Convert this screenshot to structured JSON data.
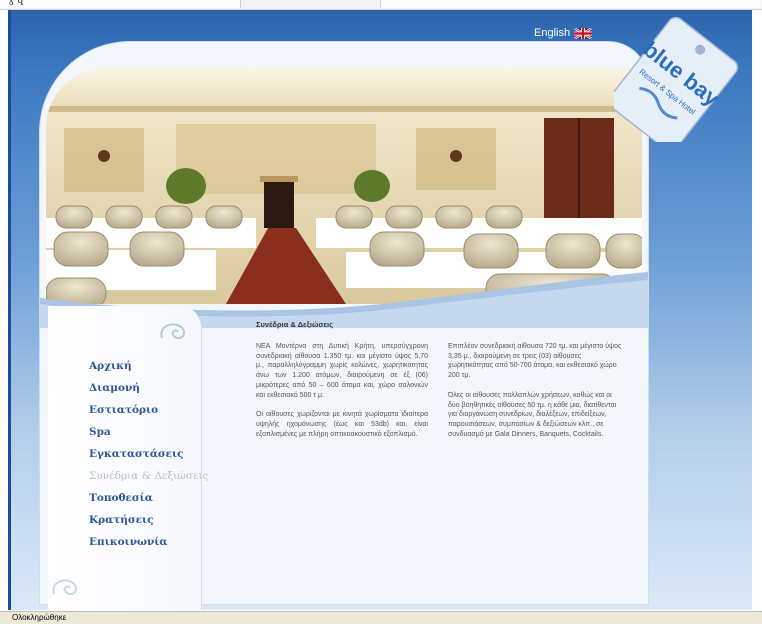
{
  "language_link": {
    "label": "English",
    "flag_icon": "uk-flag-icon"
  },
  "logo": {
    "brand": "blue bay",
    "sub": "Resort & Spa Hotel"
  },
  "nav": {
    "items": [
      {
        "label": "Αρχική",
        "active": false
      },
      {
        "label": "Διαμονή",
        "active": false
      },
      {
        "label": "Εστιατόριο",
        "active": false
      },
      {
        "label": "Spa",
        "active": false
      },
      {
        "label": "Εγκαταστάσεις",
        "active": false
      },
      {
        "label": "Συνέδρια & Δεξιώσεις",
        "active": true
      },
      {
        "label": "Τοποθεσία",
        "active": false
      },
      {
        "label": "Κρατήσεις",
        "active": false
      },
      {
        "label": "Επικοινωνία",
        "active": false
      }
    ]
  },
  "content": {
    "title": "Συνέδρια & Δεξιώσεις",
    "col1": [
      "ΝΕΑ Μοντέρνα στη Δυτική Κρήτη, υπερσύγχρονη συνεδριακή αίθουσα 1.350 τμ. και μέγιστο ύψος 5,70 μ., παραλληλόγραμμη χωρίς κολώνες, χωρητικότητας άνω των 1.200 ατόμων, διαιρούμενη σε έξ (06) μικρότερες από 50 – 600 άτομα και, χώρο σαλονιών και εκθεσιακό 500 τ.μ.",
      "Οι αίθουσες χωρίζονται με κινητά χωρίσματα ιδιαίτερα υψηλής ηχομόνωσης (έως και 53db) και, είναι εξοπλισμένες με πλήρη οπτικοακουστικό εξοπλισμό."
    ],
    "col2": [
      "Επιπλέον συνεδριακή αίθουσα 720 τμ. και μέγιστο ύψος 3,35 μ., διαιρούμενη σε τρεις (03) αίθουσες χωρητικότητας από 50-700 άτομα, και εκθεσιακό χώρο 200 τμ.",
      "Όλες οι αίθουσες πολλαπλών χρήσεων, καθώς και οι δύο βοηθητικές αίθουσες 50 τμ. η κάθε μια, διατίθενται για διοργάνωση συνεδρίων, διαλέξεων, επιδείξεων, παρουσιάσεων, συμποσίων & δεξιώσεων κλπ., σε συνδυασμό με Gala Dinners, Banquets, Cocktails."
    ]
  },
  "status_bar": {
    "text": "Ολοκληρώθηκε"
  },
  "chrome": {
    "title_glyph": "ɣ ɥ"
  },
  "colors": {
    "header_blue": "#2b64ad",
    "nav_text": "#2f5597",
    "nav_active": "#b4c1d3",
    "logo_blue": "#2a6cc0"
  }
}
